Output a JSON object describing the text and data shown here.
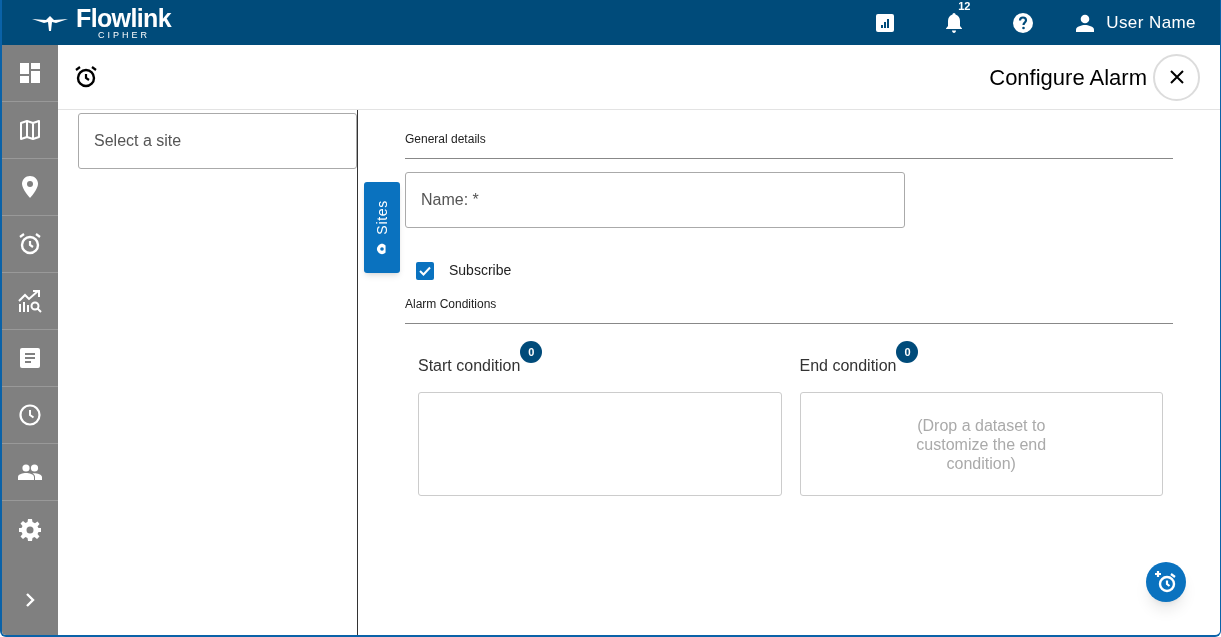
{
  "header": {
    "logo_title": "Flowlink",
    "logo_subtitle": "CIPHER",
    "notification_count": "12",
    "user_name": "User Name"
  },
  "page": {
    "title": "Configure Alarm"
  },
  "site_panel": {
    "placeholder": "Select a site"
  },
  "sites_tab": {
    "label": "Sites"
  },
  "general_details": {
    "heading": "General details",
    "name_field": {
      "placeholder": "Name: *"
    },
    "subscribe": {
      "label": "Subscribe",
      "checked": true
    }
  },
  "alarm_conditions": {
    "heading": "Alarm Conditions",
    "conditions": [
      {
        "label": "Start condition",
        "count": "0"
      },
      {
        "label": "End condition",
        "count": "0",
        "hint": "(Drop a dataset to customize the end condition)"
      }
    ]
  }
}
